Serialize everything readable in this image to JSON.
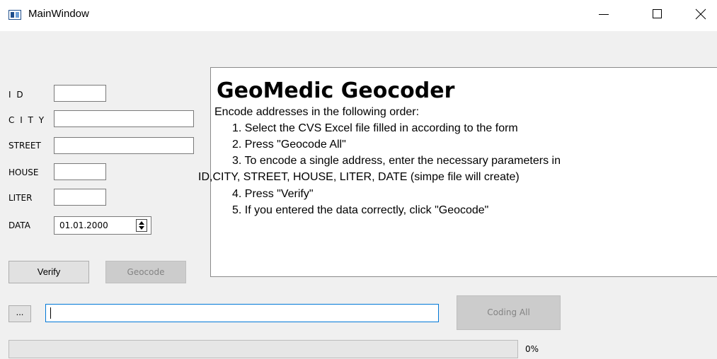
{
  "window": {
    "title": "MainWindow"
  },
  "form": {
    "id_label": "I D",
    "city_label": "C I T Y",
    "street_label": "STREET",
    "house_label": "HOUSE",
    "liter_label": "LITER",
    "data_label": "DATA",
    "id_value": "",
    "city_value": "",
    "street_value": "",
    "house_value": "",
    "liter_value": "",
    "data_value": "01.01.2000"
  },
  "buttons": {
    "verify": "Verify",
    "geocode": "Geocode",
    "browse": "...",
    "coding_all": "Coding All"
  },
  "info": {
    "title": "GeoMedic Geocoder",
    "intro": "Encode addresses in the following order:",
    "step1": "1. Select the CVS Excel file filled in according to the form",
    "step2": "2. Press \"Geocode All\"",
    "step3a": "3. To encode a single address, enter the necessary parameters in",
    "step3b": "ID,CITY, STREET, HOUSE, LITER, DATE (simpe file will create)",
    "step4": "4. Press \"Verify\"",
    "step5": "5. If you entered the data correctly, click \"Geocode\""
  },
  "file": {
    "path": ""
  },
  "progress": {
    "value": 0,
    "label": "0%"
  },
  "icons": {
    "app": "app-window-icon",
    "minimize": "minimize-icon",
    "maximize": "maximize-icon",
    "close": "close-icon",
    "spin_up": "spin-up-icon",
    "spin_down": "spin-down-icon"
  }
}
